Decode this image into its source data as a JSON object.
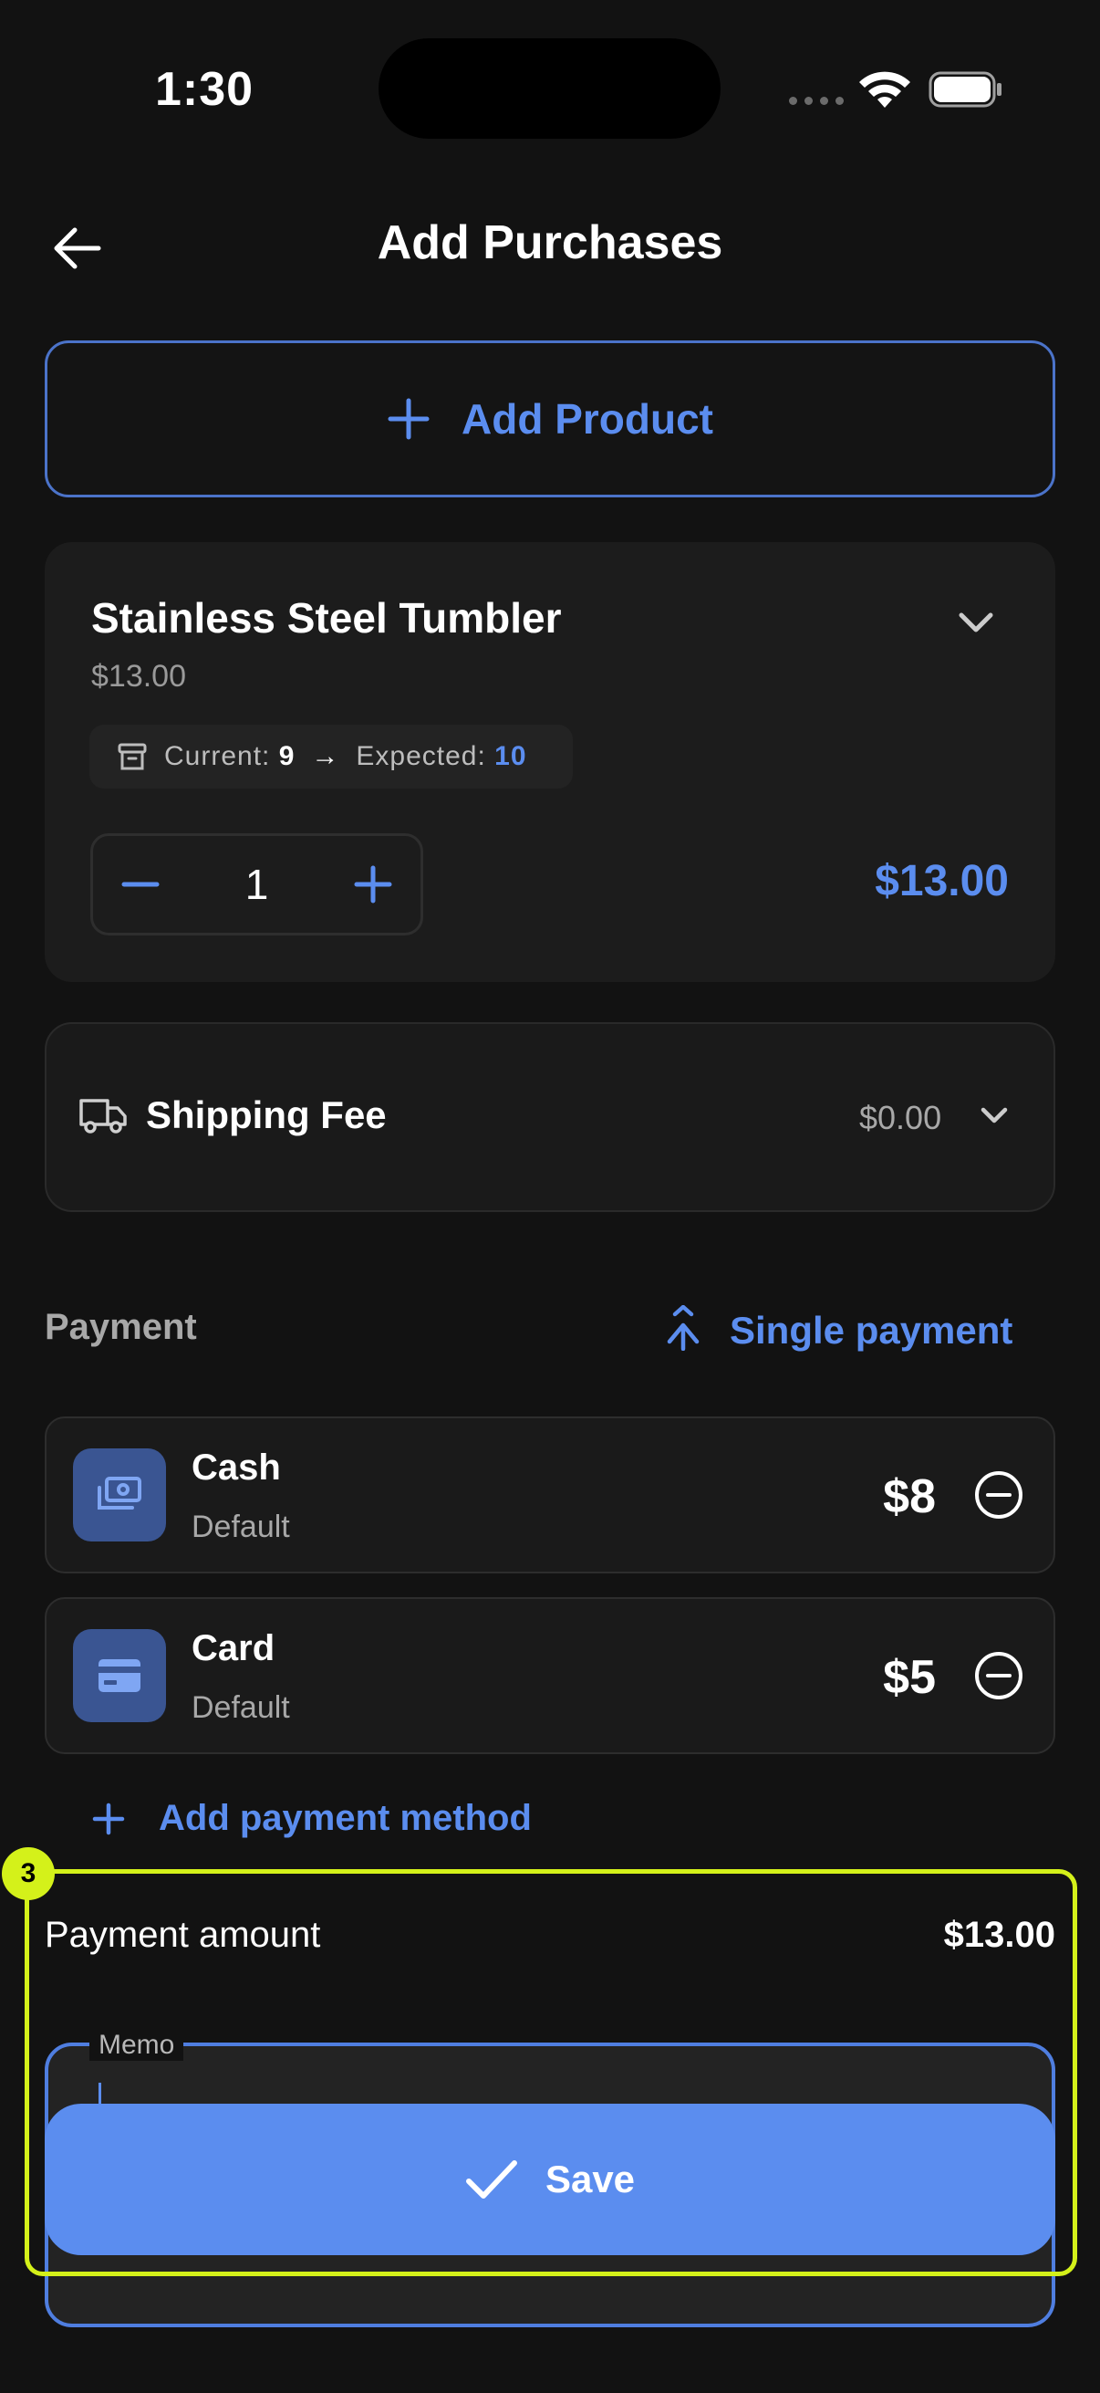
{
  "status_bar": {
    "time": "1:30"
  },
  "header": {
    "title": "Add Purchases"
  },
  "add_product": {
    "label": "Add Product"
  },
  "product": {
    "name": "Stainless Steel Tumbler",
    "unit_price": "$13.00",
    "stock_current_label": "Current:",
    "stock_current": "9",
    "stock_arrow": "→",
    "stock_expected_label": "Expected:",
    "stock_expected": "10",
    "quantity": "1",
    "line_total": "$13.00"
  },
  "shipping": {
    "label": "Shipping Fee",
    "value": "$0.00"
  },
  "payment": {
    "title": "Payment",
    "mode_label": "Single payment",
    "methods": [
      {
        "name": "Cash",
        "subtitle": "Default",
        "amount": "$8",
        "icon": "cash-icon"
      },
      {
        "name": "Card",
        "subtitle": "Default",
        "amount": "$5",
        "icon": "card-icon"
      }
    ],
    "add_method_label": "Add payment method",
    "amount_label": "Payment amount",
    "amount_value": "$13.00"
  },
  "memo": {
    "label": "Memo",
    "value": ""
  },
  "save": {
    "label": "Save"
  },
  "highlight": {
    "badge": "3"
  },
  "colors": {
    "background": "#121212",
    "card": "#1c1c1c",
    "accent": "#5b8def",
    "highlight": "#d4f11a"
  }
}
